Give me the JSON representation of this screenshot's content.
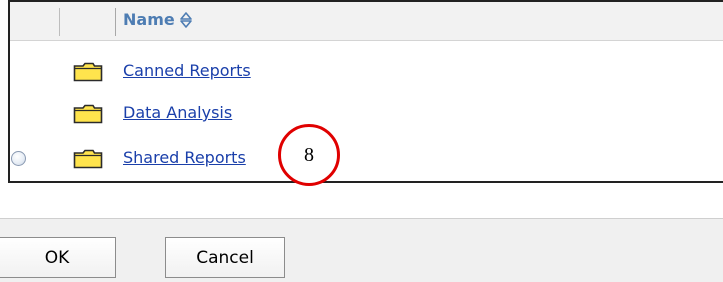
{
  "list": {
    "header": {
      "name_label": "Name"
    },
    "items": [
      {
        "label": "Canned Reports",
        "icon": "folder-icon",
        "has_radio": false
      },
      {
        "label": "Data Analysis",
        "icon": "folder-icon",
        "has_radio": false
      },
      {
        "label": "Shared Reports",
        "icon": "folder-icon",
        "has_radio": true
      }
    ]
  },
  "annotation": {
    "label": "8",
    "color": "#e00000"
  },
  "buttons": {
    "ok_label": "OK",
    "cancel_label": "Cancel"
  },
  "colors": {
    "header_text": "#4e7db3",
    "link": "#1a3faa",
    "folder_fill": "#ffe44d",
    "folder_outline": "#2b2b2b"
  }
}
